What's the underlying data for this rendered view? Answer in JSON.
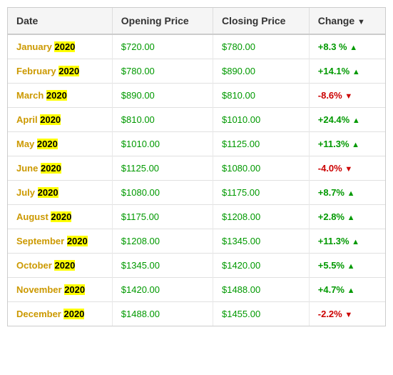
{
  "table": {
    "headers": [
      {
        "label": "Date",
        "key": "date"
      },
      {
        "label": "Opening Price",
        "key": "opening"
      },
      {
        "label": "Closing Price",
        "key": "closing"
      },
      {
        "label": "Change",
        "key": "change",
        "sortIcon": "▼"
      }
    ],
    "rows": [
      {
        "month": "January",
        "year": "2020",
        "opening": "$720.00",
        "closing": "$780.00",
        "change": "+8.3 %",
        "direction": "up"
      },
      {
        "month": "February",
        "year": "2020",
        "opening": "$780.00",
        "closing": "$890.00",
        "change": "+14.1%",
        "direction": "up"
      },
      {
        "month": "March",
        "year": "2020",
        "opening": "$890.00",
        "closing": "$810.00",
        "change": "-8.6%",
        "direction": "down"
      },
      {
        "month": "April",
        "year": "2020",
        "opening": "$810.00",
        "closing": "$1010.00",
        "change": "+24.4%",
        "direction": "up"
      },
      {
        "month": "May",
        "year": "2020",
        "opening": "$1010.00",
        "closing": "$1125.00",
        "change": "+11.3%",
        "direction": "up"
      },
      {
        "month": "June",
        "year": "2020",
        "opening": "$1125.00",
        "closing": "$1080.00",
        "change": "-4.0%",
        "direction": "down"
      },
      {
        "month": "July",
        "year": "2020",
        "opening": "$1080.00",
        "closing": "$1175.00",
        "change": "+8.7%",
        "direction": "up"
      },
      {
        "month": "August",
        "year": "2020",
        "opening": "$1175.00",
        "closing": "$1208.00",
        "change": "+2.8%",
        "direction": "up"
      },
      {
        "month": "September",
        "year": "2020",
        "opening": "$1208.00",
        "closing": "$1345.00",
        "change": "+11.3%",
        "direction": "up"
      },
      {
        "month": "October",
        "year": "2020",
        "opening": "$1345.00",
        "closing": "$1420.00",
        "change": "+5.5%",
        "direction": "up"
      },
      {
        "month": "November",
        "year": "2020",
        "opening": "$1420.00",
        "closing": "$1488.00",
        "change": "+4.7%",
        "direction": "up"
      },
      {
        "month": "December",
        "year": "2020",
        "opening": "$1488.00",
        "closing": "$1455.00",
        "change": "-2.2%",
        "direction": "down"
      }
    ]
  }
}
